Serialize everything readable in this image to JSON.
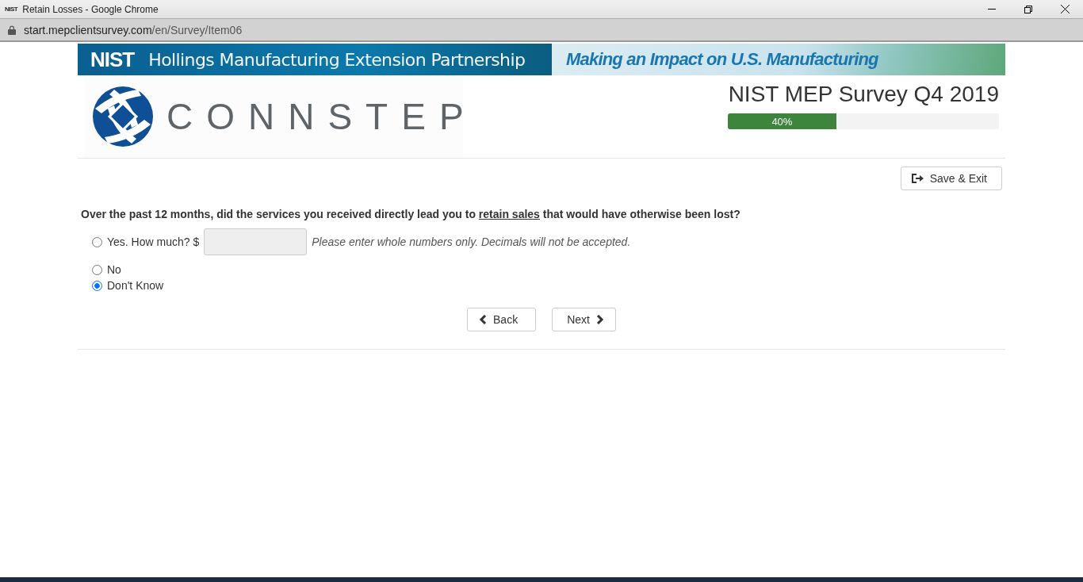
{
  "window": {
    "title": "Retain Losses - Google Chrome",
    "favicon": "NIST"
  },
  "address_bar": {
    "host": "start.mepclientsurvey.com",
    "path": "/en/Survey/Item06"
  },
  "banner": {
    "brand": "NIST",
    "program": "Hollings Manufacturing Extension Partnership",
    "tagline": "Making an Impact on U.S. Manufacturing"
  },
  "logo": {
    "name": "CONNSTEP"
  },
  "survey": {
    "title": "NIST MEP Survey Q4 2019",
    "progress_label": "40%",
    "level": 0.4
  },
  "save_exit": "Save & Exit",
  "question": {
    "before": "Over the past 12 months, did the services you received directly lead you to ",
    "underlined": "retain sales",
    "after": " that would have otherwise been lost?"
  },
  "options": [
    {
      "kind": "amount",
      "label": "Yes. How much? $",
      "hint": "Please enter whole numbers only. Decimals will not be accepted.",
      "selected": false
    },
    {
      "kind": "plain",
      "label": "No",
      "selected": false
    },
    {
      "kind": "plain",
      "label": "Don't Know",
      "selected": true
    }
  ],
  "nav": {
    "back": "Back",
    "next": "Next"
  }
}
